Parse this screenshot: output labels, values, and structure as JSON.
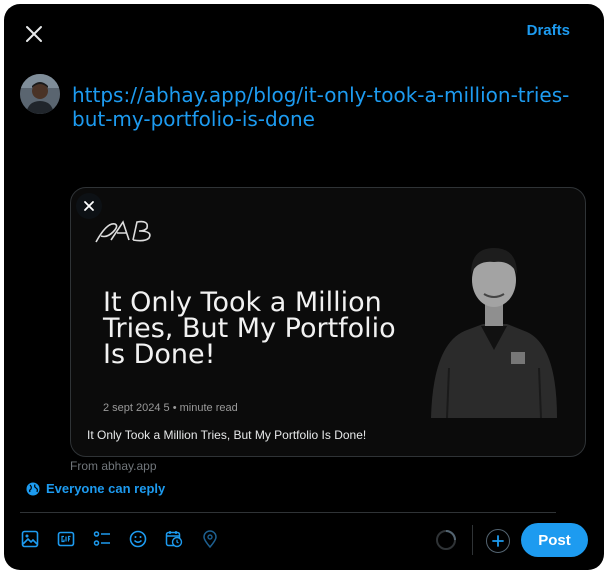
{
  "header": {
    "drafts_label": "Drafts"
  },
  "compose": {
    "text": "https://abhay.app/blog/it-only-took-a-million-tries-but-my-portfolio-is-done"
  },
  "card": {
    "logo": "AB",
    "headline": "It Only Took a Million Tries, But My Portfolio Is Done!",
    "meta": "2 sept 2024 5 • minute read",
    "caption": "It Only Took a Million Tries, But My Portfolio Is Done!",
    "source": "From abhay.app"
  },
  "reply_setting": {
    "label": "Everyone can reply"
  },
  "toolbar": {
    "icons": [
      "image-icon",
      "gif-icon",
      "poll-icon",
      "emoji-icon",
      "schedule-icon",
      "location-icon"
    ],
    "post_label": "Post"
  },
  "colors": {
    "accent": "#1d9bf0",
    "background": "#000000",
    "muted": "#71767b",
    "border": "#2f3336"
  }
}
